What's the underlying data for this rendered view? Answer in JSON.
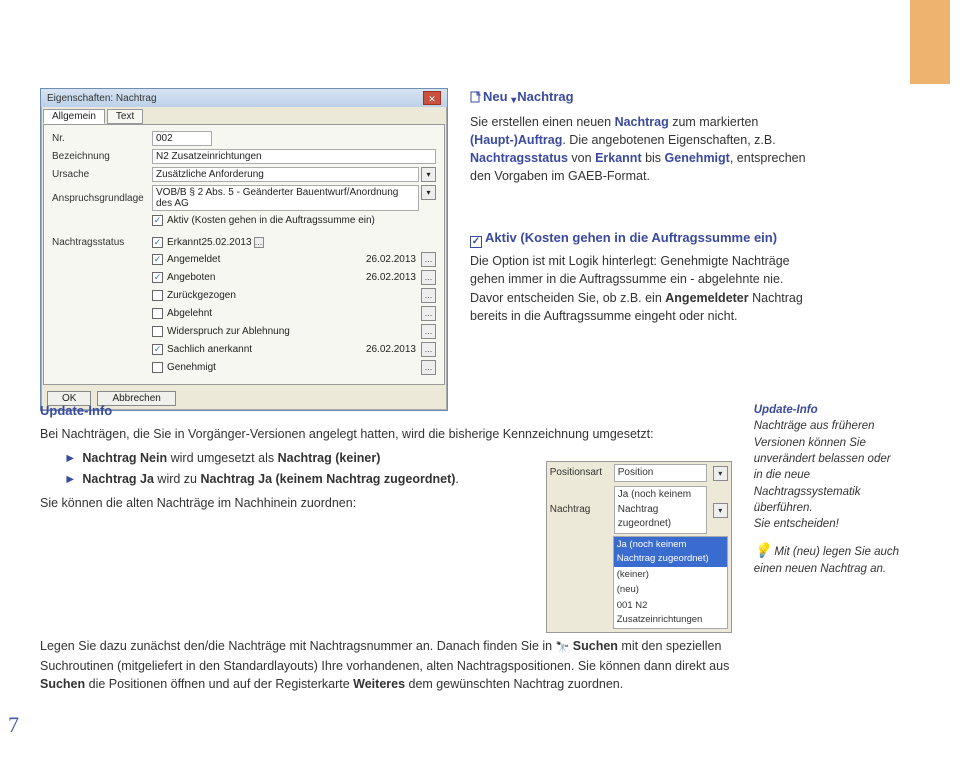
{
  "page_number": "7",
  "dialog": {
    "title": "Eigenschaften: Nachtrag",
    "tabs": [
      "Allgemein",
      "Text"
    ],
    "fields": {
      "nr_label": "Nr.",
      "nr_value": "002",
      "bez_label": "Bezeichnung",
      "bez_value": "N2 Zusatzeinrichtungen",
      "urs_label": "Ursache",
      "urs_value": "Zusätzliche Anforderung",
      "ans_label": "Anspruchsgrundlage",
      "ans_value": "VOB/B § 2 Abs. 5 - Geänderter Bauentwurf/Anordnung des AG"
    },
    "aktiv": "Aktiv (Kosten gehen in die Auftragssumme ein)",
    "status_label": "Nachtragsstatus",
    "statuses": {
      "erkannt": {
        "label": "Erkannt",
        "date": "25.02.2013",
        "checked": true
      },
      "angemeldet": {
        "label": "Angemeldet",
        "date": "26.02.2013",
        "checked": true
      },
      "angeboten": {
        "label": "Angeboten",
        "date": "26.02.2013",
        "checked": true
      },
      "zurueck": {
        "label": "Zurückgezogen",
        "date": "",
        "checked": false
      },
      "abgelehnt": {
        "label": "Abgelehnt",
        "date": "",
        "checked": false
      },
      "wider": {
        "label": "Widerspruch zur Ablehnung",
        "date": "",
        "checked": false
      },
      "sach": {
        "label": "Sachlich anerkannt",
        "date": "26.02.2013",
        "checked": true
      },
      "gen": {
        "label": "Genehmigt",
        "date": "",
        "checked": false
      }
    },
    "ok": "OK",
    "cancel": "Abbrechen"
  },
  "neu": {
    "heading_a": "Neu",
    "heading_b": "Nachtrag",
    "p1a": "Sie erstellen einen neuen ",
    "p1b": "Nachtrag",
    "p1c": " zum markierten ",
    "p1d": "(Haupt-)Auftrag",
    "p1e": ". Die angebotenen Eigenschaften, z.B. ",
    "p1f": "Nachtragsstatus",
    "p1g": " von ",
    "p1h": "Erkannt",
    "p1i": " bis ",
    "p1j": "Genehmigt",
    "p1k": ", entsprechen den Vorgaben im GAEB-Format."
  },
  "aktiv": {
    "heading": "Aktiv (Kosten gehen in die Auftragssumme ein)",
    "p1": "Die Option ist mit Logik hinterlegt: Genehmigte Nachträge gehen immer in die Auftragssumme ein - abgelehnte nie.",
    "p2a": "Davor entscheiden Sie, ob z.B. ein ",
    "p2b": "Angemeldeter",
    "p2c": " Nachtrag bereits in die Auftragssumme eingeht oder nicht."
  },
  "update": {
    "heading": "Update-Info",
    "p1": "Bei Nachträgen, die Sie in Vorgänger-Versionen angelegt hatten, wird die bisherige Kennzeichnung umgesetzt:",
    "li1a": "Nachtrag Nein",
    "li1b": " wird umgesetzt als ",
    "li1c": "Nachtrag (keiner)",
    "li2a": "Nachtrag Ja",
    "li2b": " wird zu ",
    "li2c": "Nachtrag Ja (keinem Nachtrag zugeordnet)",
    "li2d": ".",
    "p2": "Sie können die alten Nachträge im Nachhinein zuordnen:",
    "p3a": "Legen Sie dazu zunächst den/die Nachträge mit Nachtragsnummer an. Danach finden Sie in ",
    "p3b": "Suchen",
    "p3c": " mit den speziellen Suchroutinen (mitgeliefert in den Standardlayouts) Ihre vorhandenen, alten Nachtragspositionen. Sie können dann direkt aus ",
    "p3d": "Suchen",
    "p3e": " die Positionen öffnen und auf der Registerkarte ",
    "p3f": "Weiteres",
    "p3g": " dem gewünschten Nachtrag zuordnen."
  },
  "dropdown_img": {
    "r1_label": "Positionsart",
    "r1_value": "Position",
    "r2_label": "Nachtrag",
    "r2_value": "Ja (noch keinem Nachtrag zugeordnet)",
    "options": [
      "Ja (noch keinem Nachtrag zugeordnet)",
      "(keiner)",
      "(neu)",
      "001 N2 Zusatzeinrichtungen"
    ],
    "selected_index": 0
  },
  "aside": {
    "hd": "Update-Info",
    "p1": "Nachträge aus früheren Versionen können Sie unverändert belassen oder in die neue Nachtragssystematik überführen.",
    "p2": "Sie entscheiden!",
    "p3a": "Mit ",
    "p3b": "(neu)",
    "p3c": " legen Sie auch einen neuen Nachtrag an."
  }
}
